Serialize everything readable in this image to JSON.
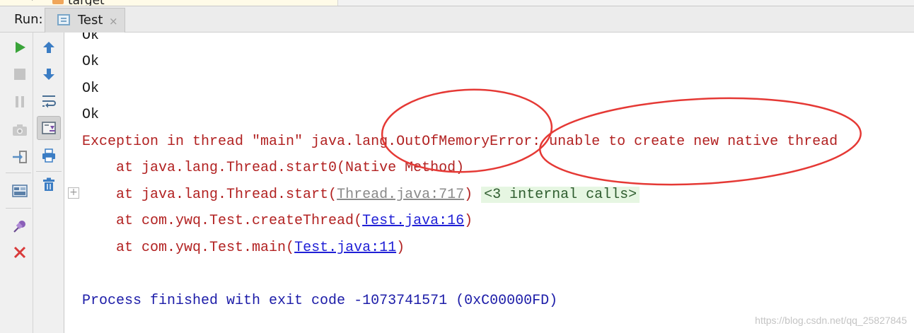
{
  "top_strip": {
    "tree_label": "target"
  },
  "run_panel": {
    "label": "Run:",
    "tab": {
      "title": "Test",
      "close_glyph": "×"
    }
  },
  "toolbar_left": [
    {
      "name": "rerun-button",
      "icon": "play-icon",
      "color": "#3aa43a"
    },
    {
      "name": "stop-button",
      "icon": "stop-icon",
      "color": "#c4c4c4"
    },
    {
      "name": "pause-button",
      "icon": "pause-icon",
      "color": "#c4c4c4"
    },
    {
      "name": "dump-threads-button",
      "icon": "camera-icon",
      "color": "#c4c4c4"
    },
    {
      "name": "exit-button",
      "icon": "exit-icon",
      "color": "#8a8a8a"
    },
    {
      "name": "restore-layout-button",
      "icon": "layout-icon",
      "color": "#5a7fa8"
    },
    {
      "name": "pin-tab-button",
      "icon": "pin-icon",
      "color": "#8a5fb8"
    },
    {
      "name": "close-button",
      "icon": "close-x-icon",
      "color": "#d93a3a"
    }
  ],
  "toolbar_right": [
    {
      "name": "up-stack-button",
      "icon": "arrow-up-icon",
      "color": "#3b7dc4"
    },
    {
      "name": "down-stack-button",
      "icon": "arrow-down-icon",
      "color": "#3b7dc4"
    },
    {
      "name": "soft-wrap-button",
      "icon": "soft-wrap-icon",
      "color": "#4a6f94"
    },
    {
      "name": "scroll-to-end-button",
      "icon": "scroll-end-icon",
      "color": "#7a4fa8"
    },
    {
      "name": "print-button",
      "icon": "printer-icon",
      "color": "#3b7dc4"
    },
    {
      "name": "clear-all-button",
      "icon": "trash-icon",
      "color": "#3b7dc4"
    }
  ],
  "console": {
    "ok_lines": [
      "Ok",
      "Ok",
      "Ok",
      "Ok"
    ],
    "exception": "Exception in thread \"main\" java.lang.OutOfMemoryError: unable to create new native thread",
    "frame1": "    at java.lang.Thread.start0(Native Method)",
    "frame2_prefix": "    at java.lang.Thread.start(",
    "frame2_link": "Thread.java:717",
    "frame2_suffix": ")",
    "frame2_fold": "<3 internal calls>",
    "fold_toggle": "+",
    "frame3_prefix": "    at com.ywq.Test.createThread(",
    "frame3_link": "Test.java:16",
    "frame3_suffix": ")",
    "frame4_prefix": "    at com.ywq.Test.main(",
    "frame4_link": "Test.java:11",
    "frame4_suffix": ")",
    "exit_message": "Process finished with exit code -1073741571 (0xC00000FD)"
  },
  "annotation_color": "#e53935",
  "watermark": "https://blog.csdn.net/qq_25827845"
}
